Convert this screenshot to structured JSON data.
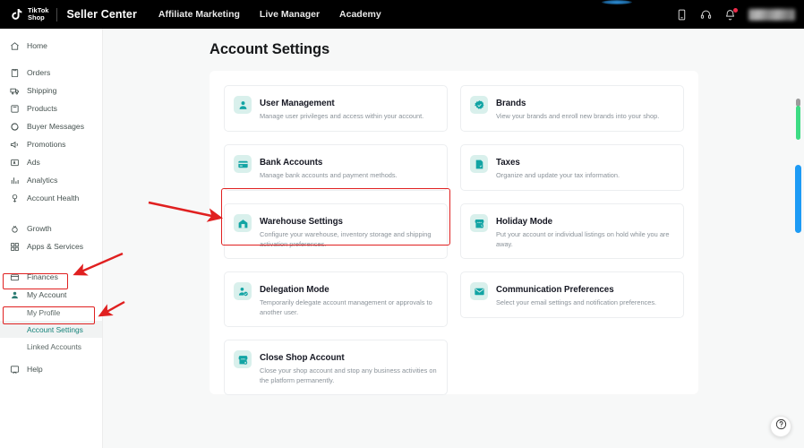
{
  "topbar": {
    "logo_name_line1": "TikTok",
    "logo_name_line2": "Shop",
    "brand": "Seller Center",
    "nav": [
      {
        "label": "Affiliate Marketing"
      },
      {
        "label": "Live Manager"
      },
      {
        "label": "Academy"
      }
    ],
    "icons": [
      {
        "name": "mobile-app-icon"
      },
      {
        "name": "headset-support-icon"
      },
      {
        "name": "notification-bell-icon",
        "badge": true
      }
    ],
    "account_name": ""
  },
  "sidebar": {
    "items": [
      {
        "label": "Home",
        "icon": "home-icon"
      },
      {
        "label": "Orders",
        "icon": "orders-icon"
      },
      {
        "label": "Shipping",
        "icon": "shipping-icon"
      },
      {
        "label": "Products",
        "icon": "products-icon"
      },
      {
        "label": "Buyer Messages",
        "icon": "message-icon"
      },
      {
        "label": "Promotions",
        "icon": "promotions-icon"
      },
      {
        "label": "Ads",
        "icon": "ads-icon"
      },
      {
        "label": "Analytics",
        "icon": "analytics-icon"
      },
      {
        "label": "Account Health",
        "icon": "account-health-icon"
      },
      {
        "label": "Growth",
        "icon": "growth-icon"
      },
      {
        "label": "Apps & Services",
        "icon": "apps-services-icon"
      },
      {
        "label": "Finances",
        "icon": "finances-icon"
      },
      {
        "label": "My Account",
        "icon": "my-account-icon"
      }
    ],
    "subitems": [
      {
        "label": "My Profile",
        "active": false
      },
      {
        "label": "Account Settings",
        "active": true
      },
      {
        "label": "Linked Accounts",
        "active": false
      }
    ],
    "help": {
      "label": "Help",
      "icon": "help-icon"
    }
  },
  "main": {
    "page_title": "Account Settings",
    "left_cards": [
      {
        "title": "User Management",
        "desc": "Manage user privileges and access within your account.",
        "icon": "user-icon"
      },
      {
        "title": "Bank Accounts",
        "desc": "Manage bank accounts and payment methods.",
        "icon": "bank-card-icon"
      },
      {
        "title": "Warehouse Settings",
        "desc": "Configure your warehouse, inventory storage and shipping activation preferences.",
        "icon": "warehouse-icon",
        "highlighted": true
      },
      {
        "title": "Delegation Mode",
        "desc": "Temporarily delegate account management or approvals to another user.",
        "icon": "delegation-icon"
      },
      {
        "title": "Close Shop Account",
        "desc": "Close your shop account and stop any business activities on the platform permanently.",
        "icon": "close-shop-icon"
      }
    ],
    "right_cards": [
      {
        "title": "Brands",
        "desc": "View your brands and enroll new brands into your shop.",
        "icon": "brand-badge-icon"
      },
      {
        "title": "Taxes",
        "desc": "Organize and update your tax information.",
        "icon": "taxes-icon"
      },
      {
        "title": "Holiday Mode",
        "desc": "Put your account or individual listings on hold while you are away.",
        "icon": "holiday-mode-icon"
      },
      {
        "title": "Communication Preferences",
        "desc": "Select your email settings and notification preferences.",
        "icon": "envelope-icon"
      }
    ]
  },
  "floating": {
    "help_button": "help-circle-icon"
  },
  "colors": {
    "brand_teal": "#12a4a4",
    "icon_bg": "#d9f0ec",
    "highlight_red": "#e02020",
    "topbar_bg": "#000000",
    "content_bg": "#f7f8f8",
    "scroll_green": "#3ddc84",
    "scroll_blue": "#1d9bf5"
  }
}
